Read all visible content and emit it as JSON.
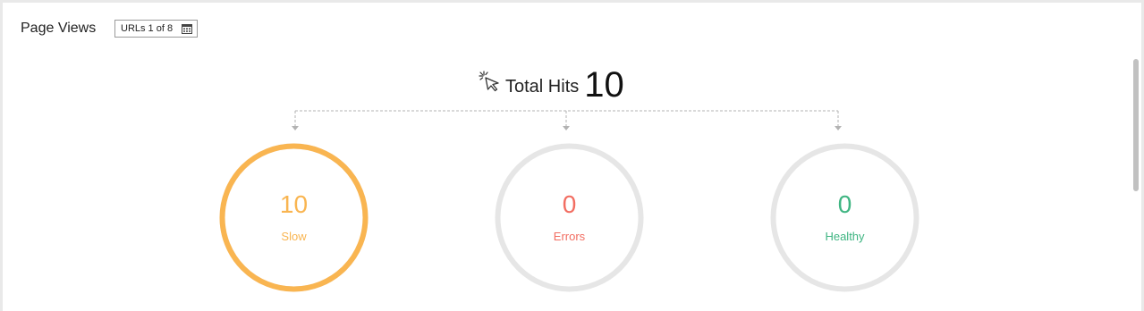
{
  "panel": {
    "title": "Page Views",
    "url_selector": {
      "label": "URLs 1 of 8",
      "icon": "calendar-icon"
    }
  },
  "total_hits": {
    "icon": "cursor-click-icon",
    "label": "Total Hits",
    "value": "10"
  },
  "metrics": [
    {
      "name": "slow",
      "value": "10",
      "label": "Slow",
      "color": "#f9b551",
      "ring_fraction": 1.0
    },
    {
      "name": "errors",
      "value": "0",
      "label": "Errors",
      "color": "#f26d61",
      "ring_fraction": 0
    },
    {
      "name": "healthy",
      "value": "0",
      "label": "Healthy",
      "color": "#3fb582",
      "ring_fraction": 0
    }
  ],
  "colors": {
    "ring_background": "#e6e6e6",
    "connector": "#b3b3b3"
  }
}
